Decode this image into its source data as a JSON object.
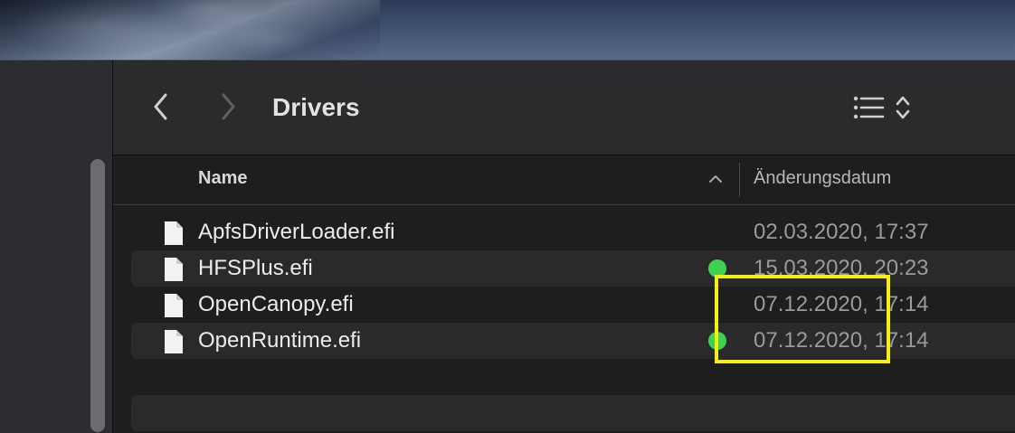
{
  "window": {
    "title": "Drivers"
  },
  "toolbar": {
    "back_icon": "chevron-left-icon",
    "forward_icon": "chevron-right-icon",
    "view_icon": "list-view-icon",
    "sort_toggle_icon": "up-down-chevron-icon"
  },
  "columns": {
    "name": "Name",
    "date": "Änderungsdatum",
    "sort_icon": "chevron-up-icon"
  },
  "files": [
    {
      "name": "ApfsDriverLoader.efi",
      "date": "02.03.2020, 17:37",
      "tag": null
    },
    {
      "name": "HFSPlus.efi",
      "date": "15.03.2020, 20:23",
      "tag": "green"
    },
    {
      "name": "OpenCanopy.efi",
      "date": "07.12.2020, 17:14",
      "tag": null
    },
    {
      "name": "OpenRuntime.efi",
      "date": "07.12.2020, 17:14",
      "tag": "green"
    }
  ],
  "colors": {
    "tag_green": "#3ed24e",
    "highlight": "#f5ee15",
    "window_bg": "#1e1e1e",
    "toolbar_bg": "#2b2b2d"
  }
}
